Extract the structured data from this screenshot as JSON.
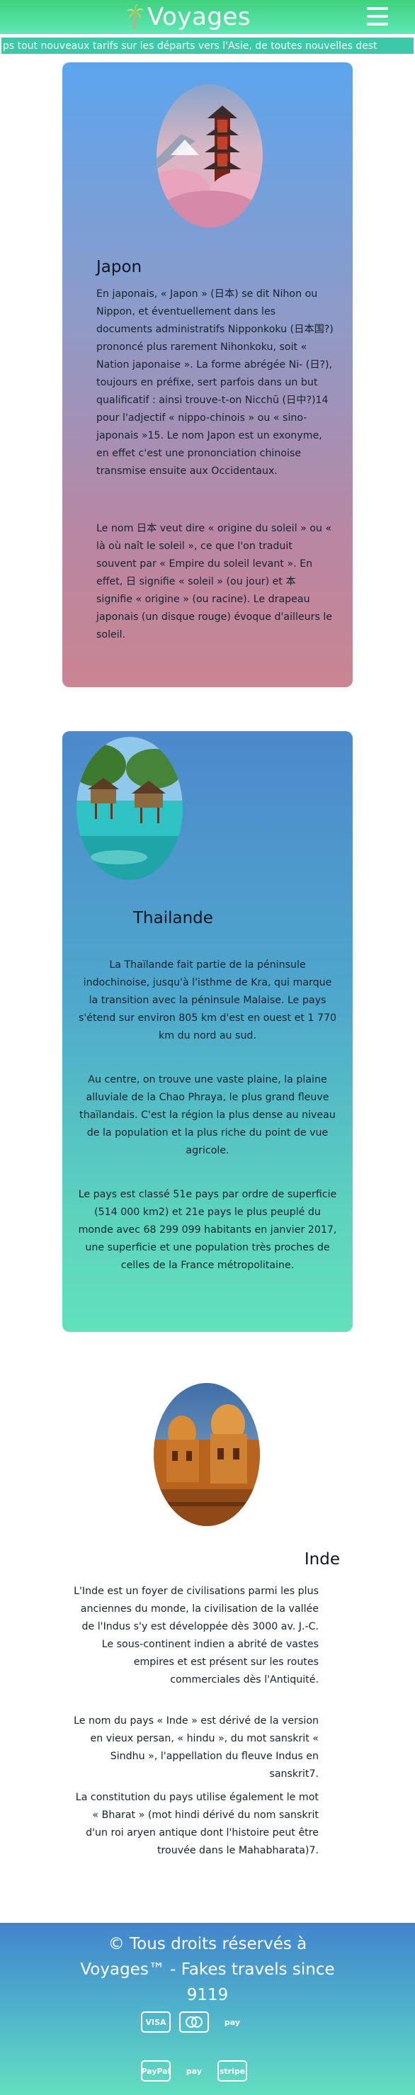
{
  "header": {
    "brand": "Voyages",
    "logo_icon": "palm-tree-icon",
    "menu_icon": "hamburger-menu-icon"
  },
  "ticker": {
    "text": "ps tout nouveaux tarifs sur les départs vers l'Asie, de toutes nouvelles dest"
  },
  "destinations": [
    {
      "title": "Japon",
      "image": "japan-pagoda-image",
      "paragraphs": [
        "En japonais, « Japon » (日本) se dit Nihon ou Nippon, et éventuellement dans les documents administratifs Nipponkoku (日本国?) prononcé plus rarement Nihonkoku, soit « Nation japonaise ». La forme abrégée Ni- (日?), toujours en préfixe, sert parfois dans un but qualificatif : ainsi trouve-t-on Nicchū (日中?)14 pour l'adjectif « nippo-chinois » ou « sino-japonais »15. Le nom Japon est un exonyme, en effet c'est une prononciation chinoise transmise ensuite aux Occidentaux.",
        "Le nom 日本 veut dire « origine du soleil » ou « là où naît le soleil », ce que l'on traduit souvent par « Empire du soleil levant ». En effet, 日 signifie « soleil » (ou jour) et 本 signifie « origine » (ou racine). Le drapeau japonais (un disque rouge) évoque d'ailleurs le soleil."
      ]
    },
    {
      "title": "Thailande",
      "image": "thailand-lagoon-image",
      "paragraphs": [
        "La Thaïlande fait partie de la péninsule indochinoise, jusqu'à l'isthme de Kra, qui marque la transition avec la péninsule Malaise. Le pays s'étend sur environ 805 km d'est en ouest et 1 770 km du nord au sud.",
        "Au centre, on trouve une vaste plaine, la plaine alluviale de la Chao Phraya, le plus grand fleuve thaïlandais. C'est la région la plus dense au niveau de la population et la plus riche du point de vue agricole.",
        "Le pays est classé 51e pays par ordre de superficie (514 000 km2) et 21e pays le plus peuplé du monde avec 68 299 099 habitants en janvier 2017, une superficie et une population très proches de celles de la France métropolitaine."
      ]
    },
    {
      "title": "Inde",
      "image": "india-temple-image",
      "paragraphs": [
        "L'Inde est un foyer de civilisations parmi les plus anciennes du monde, la civilisation de la vallée de l'Indus s'y est développée dès 3000 av. J.-C. Le sous-continent indien a abrité de vastes empires et est présent sur les routes commerciales dès l'Antiquité.",
        "Le nom du pays « Inde » est dérivé de la version en vieux persan, « hindu », du mot sanskrit « Sindhu », l'appellation du fleuve Indus en sanskrit7.",
        "La constitution du pays utilise également le mot « Bharat » (mot hindi dérivé du nom sanskrit d'un roi aryen antique dont l'histoire peut être trouvée dans le Mahabharata)7."
      ]
    }
  ],
  "footer": {
    "text": "© Tous droits réservés à Voyages™ - Fakes travels since 9119",
    "payments_row1": [
      "VISA",
      "",
      "pay"
    ],
    "payments_row2": [
      "PayPal",
      "pay",
      "stripe"
    ],
    "payment_icons": [
      "visa-icon",
      "mastercard-icon",
      "amazon-pay-icon",
      "paypal-icon",
      "apple-pay-icon",
      "stripe-icon"
    ]
  }
}
